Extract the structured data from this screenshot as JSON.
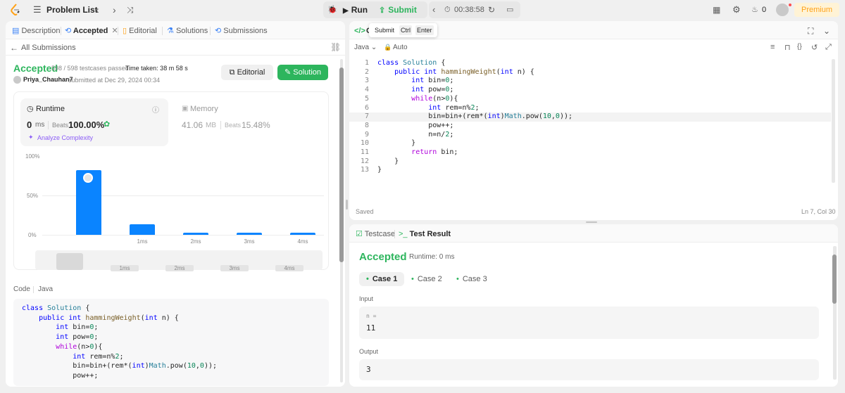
{
  "topbar": {
    "title": "Problem List",
    "run_label": "Run",
    "submit_label": "Submit",
    "timer": "00:38:58",
    "streak_count": "0",
    "premium_label": "Premium"
  },
  "left_tabs": [
    {
      "label": "Description"
    },
    {
      "label": "Accepted"
    },
    {
      "label": "Editorial"
    },
    {
      "label": "Solutions"
    },
    {
      "label": "Submissions"
    }
  ],
  "submission": {
    "back_label": "All Submissions",
    "status": "Accepted",
    "testcases": "598 / 598 testcases passed",
    "time_taken": "Time taken: 38 m 58 s",
    "user": "Priya_Chauhan7",
    "submitted_at": "submitted at Dec 29, 2024 00:34",
    "editorial_button": "Editorial",
    "solution_button": "Solution"
  },
  "runtime": {
    "label": "Runtime",
    "value": "0",
    "unit": "ms",
    "beats_label": "Beats",
    "beats_value": "100.00%",
    "analyze_label": "Analyze Complexity"
  },
  "memory": {
    "label": "Memory",
    "value": "41.06",
    "unit": "MB",
    "beats_label": "Beats",
    "beats_value": "15.48%"
  },
  "chart_data": {
    "type": "bar",
    "categories": [
      "0ms",
      "1ms",
      "2ms",
      "3ms",
      "4ms"
    ],
    "x_tick_labels": [
      "",
      "1ms",
      "2ms",
      "3ms",
      "4ms"
    ],
    "values": [
      82,
      13,
      3,
      3,
      3
    ],
    "y_tick_labels": [
      "100%",
      "50%",
      "0%"
    ],
    "ylim": [
      0,
      100
    ],
    "highlighted_category": "0ms",
    "bar_color": "#0a84ff",
    "mini_labels": [
      "1ms",
      "2ms",
      "3ms",
      "4ms"
    ]
  },
  "code_section": {
    "label": "Code",
    "language": "Java",
    "lines": [
      "class Solution {",
      "    public int hammingWeight(int n) {",
      "        int bin=0;",
      "        int pow=0;",
      "        while(n>0){",
      "            int rem=n%2;",
      "            bin=bin+(rem*(int)Math.pow(10,0));",
      "            pow++;"
    ]
  },
  "editor": {
    "tooltip": {
      "action": "Submit",
      "key1": "Ctrl",
      "key2": "Enter"
    },
    "language": "Java",
    "autosave_mode": "Auto",
    "status_left": "Saved",
    "status_right": "Ln 7, Col 30",
    "line_numbers": [
      "1",
      "2",
      "3",
      "4",
      "5",
      "6",
      "7",
      "8",
      "9",
      "10",
      "11",
      "12",
      "13"
    ],
    "lines": [
      "class Solution {",
      "    public int hammingWeight(int n) {",
      "        int bin=0;",
      "        int pow=0;",
      "        while(n>0){",
      "            int rem=n%2;",
      "            bin=bin+(rem*(int)Math.pow(10,0));",
      "            pow++;",
      "            n=n/2;",
      "        }",
      "        return bin;",
      "    }",
      "}"
    ]
  },
  "result": {
    "tab_testcase": "Testcase",
    "tab_result": "Test Result",
    "status": "Accepted",
    "runtime": "Runtime: 0 ms",
    "cases": [
      "Case 1",
      "Case 2",
      "Case 3"
    ],
    "input_label": "Input",
    "input_var": "n =",
    "input_value": "11",
    "output_label": "Output",
    "output_value": "3"
  },
  "colors": {
    "accent_green": "#2db55d",
    "brand_orange": "#ffa116",
    "bar_blue": "#0a84ff"
  }
}
